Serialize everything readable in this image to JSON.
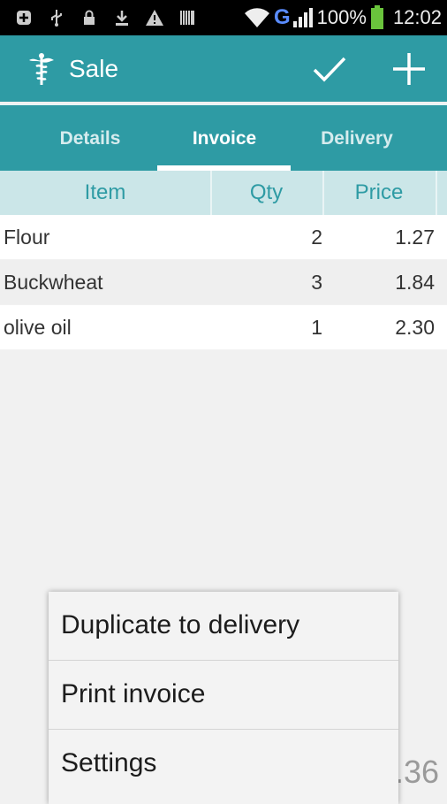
{
  "status_bar": {
    "battery": "100%",
    "time": "12:02",
    "carrier": "G",
    "icons": [
      "notification-icon",
      "usb-icon",
      "lock-icon",
      "download-icon",
      "warning-icon",
      "barcode-icon",
      "wifi-icon",
      "signal-icon",
      "battery-icon"
    ]
  },
  "action_bar": {
    "title": "Sale",
    "logo_icon": "caduceus-icon",
    "actions": [
      "check-icon",
      "plus-icon"
    ]
  },
  "tabs": [
    {
      "label": "Details",
      "active": false
    },
    {
      "label": "Invoice",
      "active": true
    },
    {
      "label": "Delivery",
      "active": false
    }
  ],
  "table": {
    "headers": [
      "Item",
      "Qty",
      "Price"
    ],
    "rows": [
      {
        "item": "Flour",
        "qty": "2",
        "price": "1.27"
      },
      {
        "item": "Buckwheat",
        "qty": "3",
        "price": "1.84"
      },
      {
        "item": "olive oil",
        "qty": "1",
        "price": "2.30"
      }
    ]
  },
  "version_partial": ".36",
  "menu": {
    "items": [
      "Duplicate to delivery",
      "Print invoice",
      "Settings"
    ]
  },
  "colors": {
    "primary": "#2e9ba4",
    "header_bg": "#cbe6e8",
    "background": "#f1f1f1"
  }
}
